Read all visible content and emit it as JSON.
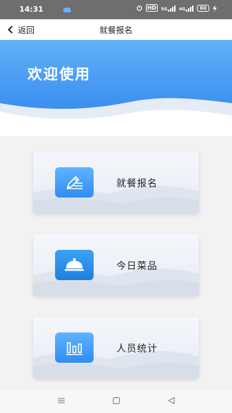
{
  "status_bar": {
    "time": "14:31",
    "network_badge": "HD",
    "signal_1_label": "5G",
    "signal_2_label": "4G",
    "battery": "60"
  },
  "nav": {
    "back_label": "返回",
    "title": "就餐报名"
  },
  "banner": {
    "title": "欢迎使用",
    "gradient_top": "#5aaaf5",
    "gradient_bottom": "#3d8ff0"
  },
  "menu": [
    {
      "label": "就餐报名",
      "icon": "pencil-write-icon"
    },
    {
      "label": "今日菜品",
      "icon": "food-cloche-icon"
    },
    {
      "label": "人员统计",
      "icon": "bar-chart-icon"
    }
  ],
  "system_nav": {
    "buttons": [
      "menu-icon",
      "home-icon",
      "back-triangle-icon"
    ]
  },
  "colors": {
    "accent": "#3a8ff0",
    "card_bg": "#eef1f7",
    "page_bg": "#f2f2f2"
  }
}
